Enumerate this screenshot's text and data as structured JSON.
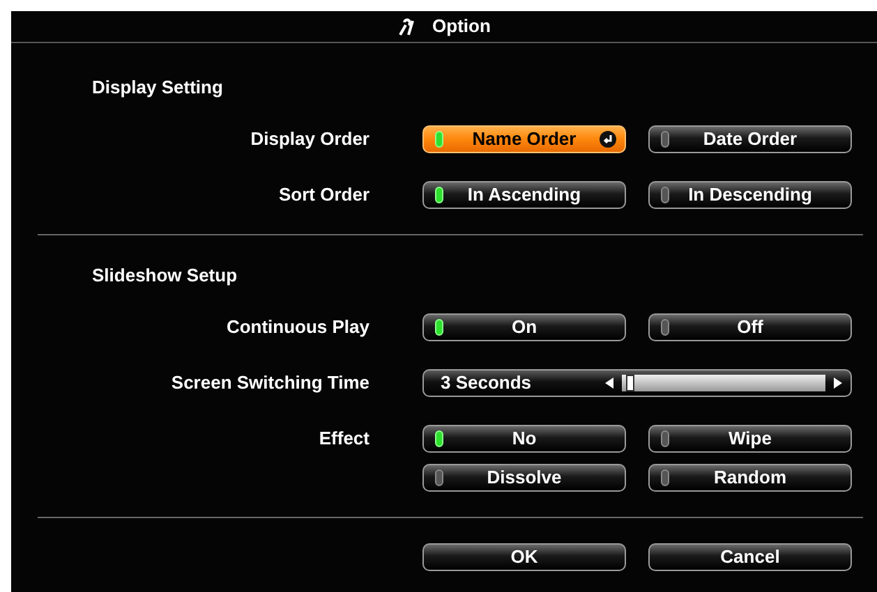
{
  "title": "Option",
  "sections": [
    {
      "heading": "Display Setting",
      "rows": [
        {
          "kind": "choice",
          "label": "Display Order",
          "options": [
            {
              "label": "Name Order",
              "selected": true,
              "focused": true
            },
            {
              "label": "Date Order",
              "selected": false,
              "focused": false
            }
          ]
        },
        {
          "kind": "choice",
          "label": "Sort Order",
          "options": [
            {
              "label": "In Ascending",
              "selected": true,
              "focused": false
            },
            {
              "label": "In Descending",
              "selected": false,
              "focused": false
            }
          ]
        }
      ]
    },
    {
      "heading": "Slideshow Setup",
      "rows": [
        {
          "kind": "choice",
          "label": "Continuous Play",
          "options": [
            {
              "label": "On",
              "selected": true,
              "focused": false
            },
            {
              "label": "Off",
              "selected": false,
              "focused": false
            }
          ]
        },
        {
          "kind": "slider",
          "label": "Screen Switching Time",
          "value": "3 Seconds",
          "level": 0.02
        },
        {
          "kind": "choice",
          "label": "Effect",
          "options": [
            {
              "label": "No",
              "selected": true,
              "focused": false
            },
            {
              "label": "Wipe",
              "selected": false,
              "focused": false
            },
            {
              "label": "Dissolve",
              "selected": false,
              "focused": false
            },
            {
              "label": "Random",
              "selected": false,
              "focused": false
            }
          ]
        }
      ]
    }
  ],
  "buttons": [
    {
      "label": "OK"
    },
    {
      "label": "Cancel"
    }
  ]
}
